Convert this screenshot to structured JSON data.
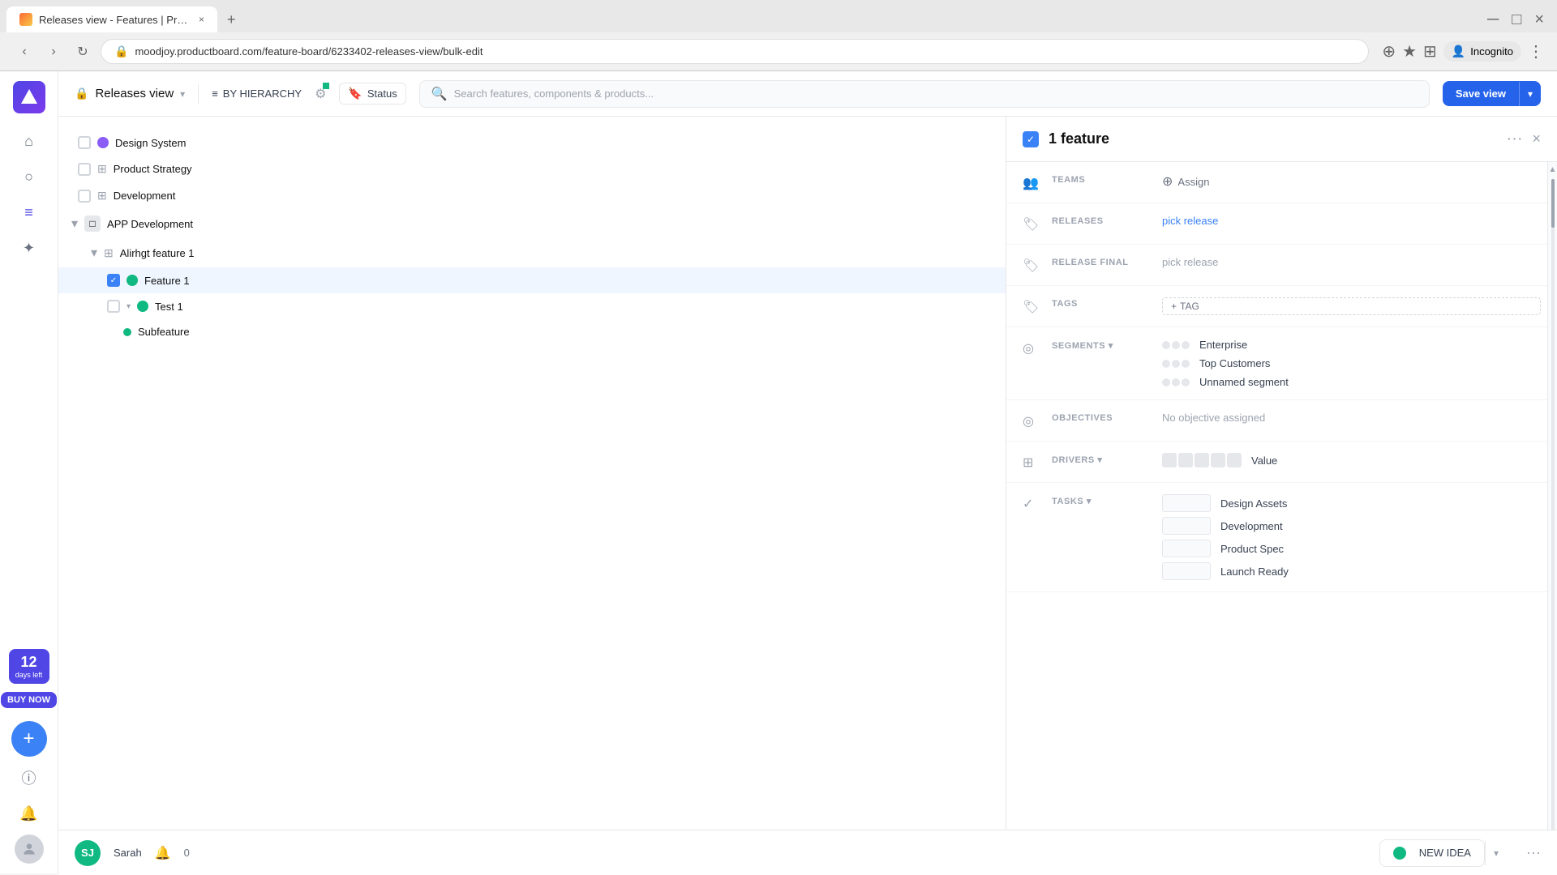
{
  "browser": {
    "tab_title": "Releases view - Features | Produ...",
    "tab_close": "×",
    "new_tab": "+",
    "url": "moodjoy.productboard.com/feature-board/6233402-releases-view/bulk-edit",
    "nav_back": "‹",
    "nav_forward": "›",
    "nav_refresh": "↻",
    "incognito_label": "Incognito"
  },
  "topbar": {
    "view_title": "Releases view",
    "hierarchy_label": "BY HIERARCHY",
    "status_label": "Status",
    "search_placeholder": "Search features, components & products...",
    "save_view_label": "Save view"
  },
  "sidebar": {
    "icons": [
      "⌂",
      "○",
      "≡",
      "✦",
      "ⓘ",
      "🔔"
    ],
    "trial_days": "12",
    "trial_label": "days left",
    "buy_label": "BUY NOW",
    "add_label": "+"
  },
  "feature_list": {
    "sections": [
      {
        "name": "Design System",
        "color": "purple",
        "indent": 0
      },
      {
        "name": "Product Strategy",
        "color": null,
        "indent": 0,
        "is_grid": true
      },
      {
        "name": "Development",
        "color": null,
        "indent": 0,
        "is_grid": true
      },
      {
        "name": "APP Development",
        "color": null,
        "indent": 0,
        "is_folder": true
      }
    ],
    "sub_items": [
      {
        "name": "Alirhgt feature 1",
        "indent": 1,
        "is_grid": true,
        "toggled": true
      },
      {
        "name": "Feature 1",
        "indent": 2,
        "color": "green",
        "selected": true
      },
      {
        "name": "Test 1",
        "indent": 2,
        "color": "green",
        "toggled": true
      },
      {
        "name": "Subfeature",
        "indent": 3,
        "color": "green",
        "small": true
      }
    ]
  },
  "right_panel": {
    "header": {
      "title": "1 feature",
      "more_icon": "···",
      "close_icon": "×"
    },
    "rows": [
      {
        "id": "teams",
        "label": "TEAMS",
        "value": "Assign",
        "type": "assign"
      },
      {
        "id": "releases",
        "label": "RELEASES",
        "value": "pick release",
        "type": "link"
      },
      {
        "id": "release_final",
        "label": "RELEASE FINAL",
        "value": "pick release",
        "type": "gray"
      },
      {
        "id": "tags",
        "label": "TAGS",
        "value": "+ TAG",
        "type": "tag"
      },
      {
        "id": "segments",
        "label": "SEGMENTS",
        "value": "",
        "type": "segments",
        "segments": [
          {
            "name": "Enterprise"
          },
          {
            "name": "Top Customers"
          },
          {
            "name": "Unnamed segment"
          }
        ]
      },
      {
        "id": "objectives",
        "label": "OBJECTIVES",
        "value": "No objective assigned",
        "type": "none"
      },
      {
        "id": "drivers",
        "label": "DRIVERS",
        "value": "Value",
        "type": "drivers"
      },
      {
        "id": "tasks",
        "label": "TASKS",
        "value": "",
        "type": "tasks",
        "tasks": [
          {
            "name": "Design Assets"
          },
          {
            "name": "Development"
          },
          {
            "name": "Product Spec"
          },
          {
            "name": "Launch Ready"
          }
        ]
      }
    ]
  },
  "bottom_bar": {
    "user_initials": "SJ",
    "user_name": "Sarah",
    "notify_icon": "🔔",
    "notify_count": "0",
    "new_idea_label": "NEW IDEA",
    "more_icon": "···"
  }
}
